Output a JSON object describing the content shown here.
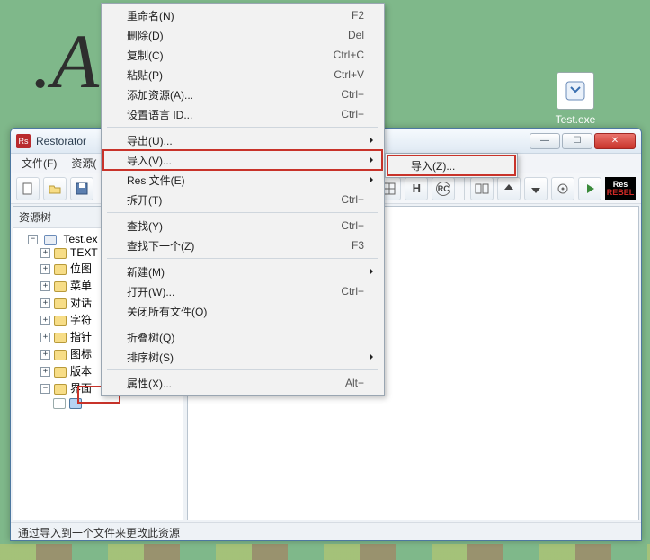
{
  "desktop": {
    "icon_label": "Test.exe"
  },
  "window": {
    "title_prefix": "Restorator",
    "min_glyph": "—",
    "max_glyph": "☐",
    "close_glyph": "✕"
  },
  "menubar": {
    "file": "文件(F)",
    "resource": "资源("
  },
  "tree": {
    "header": "资源树",
    "root": "Test.ex",
    "items": [
      "TEXT",
      "位图",
      "菜单",
      "对话",
      "字符",
      "指针",
      "图标",
      "版本",
      "界面"
    ]
  },
  "statusbar": {
    "text": "通过导入到一个文件来更改此资源"
  },
  "context_menu": {
    "items": [
      {
        "label": "重命名(N)",
        "shortcut": "F2"
      },
      {
        "label": "删除(D)",
        "shortcut": "Del"
      },
      {
        "label": "复制(C)",
        "shortcut": "Ctrl+C"
      },
      {
        "label": "粘贴(P)",
        "shortcut": "Ctrl+V"
      },
      {
        "label": "添加资源(A)...",
        "shortcut": "Ctrl+"
      },
      {
        "label": "设置语言 ID...",
        "shortcut": "Ctrl+"
      },
      {
        "sep": true
      },
      {
        "label": "导出(U)...",
        "submenu": true
      },
      {
        "label": "导入(V)...",
        "submenu": true,
        "highlight": true
      },
      {
        "label": "Res 文件(E)",
        "submenu": true
      },
      {
        "label": "拆开(T)",
        "shortcut": "Ctrl+"
      },
      {
        "sep": true
      },
      {
        "label": "查找(Y)",
        "shortcut": "Ctrl+"
      },
      {
        "label": "查找下一个(Z)",
        "shortcut": "F3"
      },
      {
        "sep": true
      },
      {
        "label": "新建(M)",
        "submenu": true
      },
      {
        "label": "打开(W)...",
        "shortcut": "Ctrl+"
      },
      {
        "label": "关闭所有文件(O)"
      },
      {
        "sep": true
      },
      {
        "label": "折叠树(Q)"
      },
      {
        "label": "排序树(S)",
        "submenu": true
      },
      {
        "sep": true
      },
      {
        "label": "属性(X)...",
        "shortcut": "Alt+"
      }
    ]
  },
  "submenu": {
    "items": [
      {
        "label": "导入(Z)...",
        "highlight": true
      }
    ]
  }
}
